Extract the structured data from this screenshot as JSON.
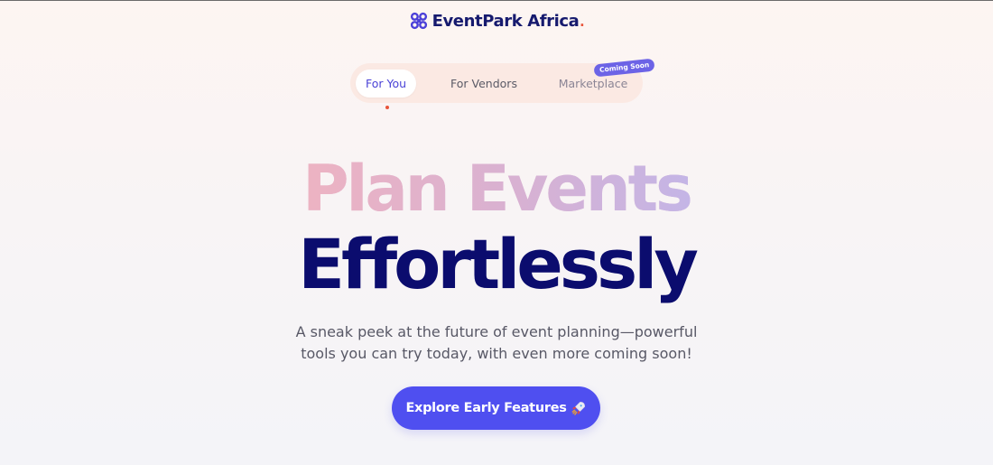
{
  "brand": {
    "name": "EventPark Africa",
    "dot": ".",
    "icon": "event-park-logo-icon",
    "color": "#161a6e",
    "dot_color": "#e8543a"
  },
  "tabs": [
    {
      "label": "For You",
      "active": true
    },
    {
      "label": "For Vendors",
      "active": false
    },
    {
      "label": "Marketplace",
      "active": false,
      "badge": "Coming Soon"
    }
  ],
  "hero": {
    "headline_line1": "Plan Events",
    "headline_line2": "Effortlessly",
    "subtitle_line1": "A sneak peek at the future of event planning—powerful",
    "subtitle_line2": "tools you can try today, with even more coming soon!",
    "cta_label": "Explore Early Features",
    "cta_icon": "rocket-icon"
  },
  "colors": {
    "accent": "#4f4ff0",
    "headline_dark": "#0b0c6e",
    "headline_gradient_start": "#edb3c2",
    "headline_gradient_end": "#c7b3e2",
    "badge": "#6c63e6",
    "tabs_bg": "#fbe9e3"
  }
}
